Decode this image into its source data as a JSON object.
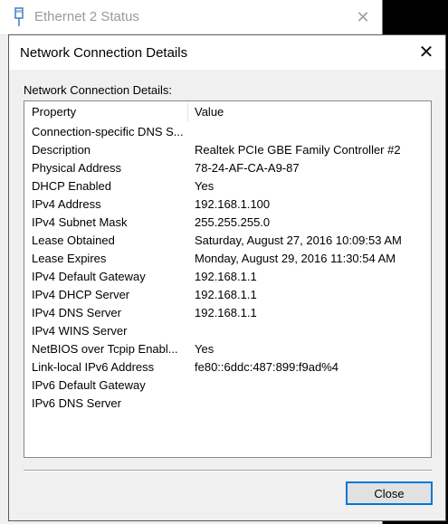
{
  "parent_window": {
    "title": "Ethernet 2 Status",
    "icon": "network-adapter-icon"
  },
  "dialog": {
    "title": "Network Connection Details",
    "group_label": "Network Connection Details:",
    "columns": {
      "property": "Property",
      "value": "Value"
    },
    "rows": [
      {
        "property": "Connection-specific DNS S...",
        "value": ""
      },
      {
        "property": "Description",
        "value": "Realtek PCIe GBE Family Controller #2"
      },
      {
        "property": "Physical Address",
        "value": "78-24-AF-CA-A9-87"
      },
      {
        "property": "DHCP Enabled",
        "value": "Yes"
      },
      {
        "property": "IPv4 Address",
        "value": "192.168.1.100"
      },
      {
        "property": "IPv4 Subnet Mask",
        "value": "255.255.255.0"
      },
      {
        "property": "Lease Obtained",
        "value": "Saturday, August 27, 2016 10:09:53 AM"
      },
      {
        "property": "Lease Expires",
        "value": "Monday, August 29, 2016 11:30:54 AM"
      },
      {
        "property": "IPv4 Default Gateway",
        "value": "192.168.1.1"
      },
      {
        "property": "IPv4 DHCP Server",
        "value": "192.168.1.1"
      },
      {
        "property": "IPv4 DNS Server",
        "value": "192.168.1.1"
      },
      {
        "property": "IPv4 WINS Server",
        "value": ""
      },
      {
        "property": "NetBIOS over Tcpip Enabl...",
        "value": "Yes"
      },
      {
        "property": "Link-local IPv6 Address",
        "value": "fe80::6ddc:487:899:f9ad%4"
      },
      {
        "property": "IPv6 Default Gateway",
        "value": ""
      },
      {
        "property": "IPv6 DNS Server",
        "value": ""
      }
    ],
    "close_button": "Close"
  },
  "colors": {
    "accent": "#0078d7",
    "window_bg": "#f0f0f0",
    "list_bg": "#ffffff"
  }
}
